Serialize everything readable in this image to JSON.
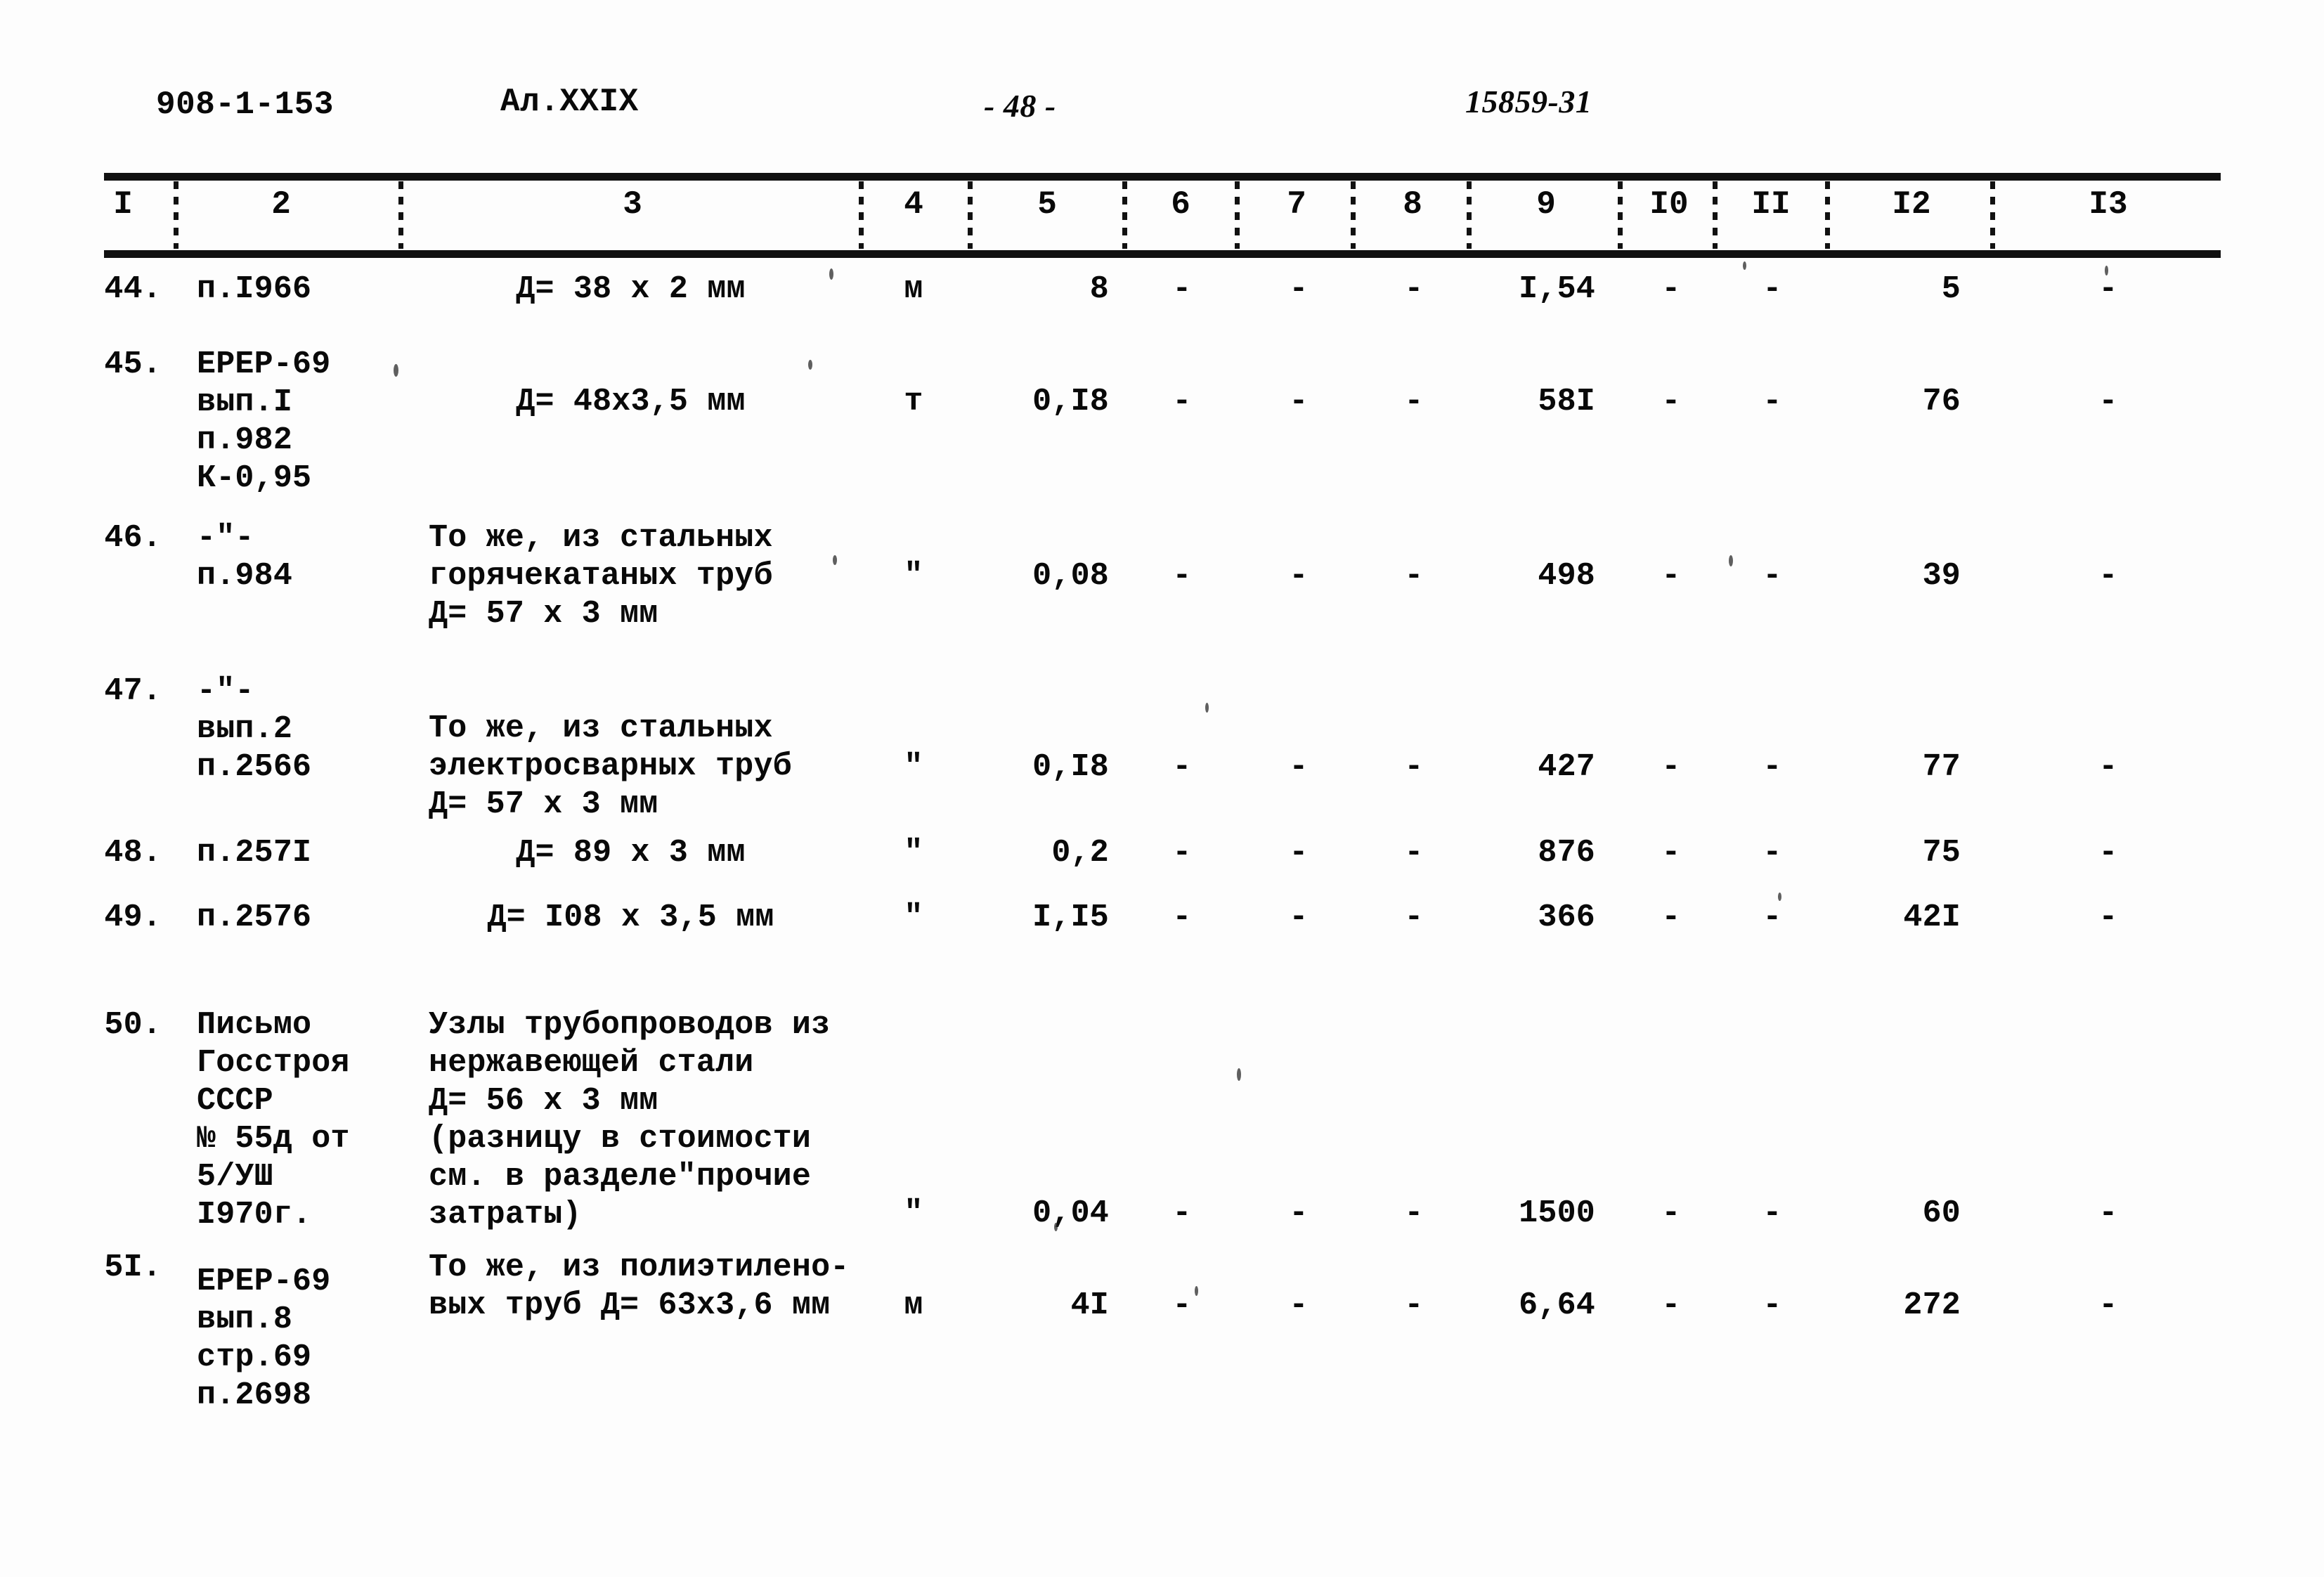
{
  "header": {
    "doc_code": "908-1-153",
    "album": "Ал.XXIX",
    "page_marker": "- 48 -",
    "stamp": "15859-31"
  },
  "table": {
    "column_headers": [
      "I",
      "2",
      "3",
      "4",
      "5",
      "6",
      "7",
      "8",
      "9",
      "I0",
      "II",
      "I2",
      "I3"
    ],
    "rows": [
      {
        "no": "44.",
        "code": [
          "п.I966"
        ],
        "desc": [
          "Д= 38 х 2 мм"
        ],
        "unit": "м",
        "c5": "8",
        "c6": "-",
        "c7": "-",
        "c8": "-",
        "c9": "I,54",
        "c10": "-",
        "c11": "-",
        "c12": "5",
        "c13": "-"
      },
      {
        "no": "45.",
        "code": [
          "ЕРЕР-69",
          "вып.I",
          "п.982",
          "К-0,95"
        ],
        "desc": [
          "Д= 48х3,5 мм"
        ],
        "unit": "т",
        "c5": "0,I8",
        "c6": "-",
        "c7": "-",
        "c8": "-",
        "c9": "58I",
        "c10": "-",
        "c11": "-",
        "c12": "76",
        "c13": "-"
      },
      {
        "no": "46.",
        "code": [
          "-\"-",
          "п.984"
        ],
        "desc": [
          "То же, из стальных",
          "горячекатаных труб",
          "Д= 57 х 3 мм"
        ],
        "unit": "\"",
        "c5": "0,08",
        "c6": "-",
        "c7": "-",
        "c8": "-",
        "c9": "498",
        "c10": "-",
        "c11": "-",
        "c12": "39",
        "c13": "-"
      },
      {
        "no": "47.",
        "code": [
          "-\"-",
          "вып.2",
          "п.2566"
        ],
        "desc": [
          "То же, из стальных",
          "электросварных труб",
          "Д= 57 х 3 мм"
        ],
        "unit": "\"",
        "c5": "0,I8",
        "c6": "-",
        "c7": "-",
        "c8": "-",
        "c9": "427",
        "c10": "-",
        "c11": "-",
        "c12": "77",
        "c13": "-"
      },
      {
        "no": "48.",
        "code": [
          "п.257I"
        ],
        "desc": [
          "Д= 89 х 3 мм"
        ],
        "unit": "\"",
        "c5": "0,2",
        "c6": "-",
        "c7": "-",
        "c8": "-",
        "c9": "876",
        "c10": "-",
        "c11": "-",
        "c12": "75",
        "c13": "-"
      },
      {
        "no": "49.",
        "code": [
          "п.2576"
        ],
        "desc": [
          "Д= I08 х 3,5 мм"
        ],
        "unit": "\"",
        "c5": "I,I5",
        "c6": "-",
        "c7": "-",
        "c8": "-",
        "c9": "366",
        "c10": "-",
        "c11": "-",
        "c12": "42I",
        "c13": "-"
      },
      {
        "no": "50.",
        "code": [
          "Письмо",
          "Госстроя",
          "СССР",
          "№ 55д от",
          "5/УШ",
          "I970г."
        ],
        "desc": [
          "Узлы трубопроводов из",
          "нержавеющей стали",
          "Д= 56 х 3 мм",
          "(разницу в стоимости",
          "см. в разделе\"прочие",
          "затраты)"
        ],
        "unit": "\"",
        "c5": "0,04",
        "c6": "-",
        "c7": "-",
        "c8": "-",
        "c9": "1500",
        "c10": "-",
        "c11": "-",
        "c12": "60",
        "c13": "-"
      },
      {
        "no": "5I.",
        "code": [
          "ЕРЕР-69",
          "вып.8",
          "стр.69",
          "п.2698"
        ],
        "desc": [
          "То же, из полиэтилено-",
          "вых труб Д= 63х3,6 мм"
        ],
        "unit": "м",
        "c5": "4I",
        "c6": "-",
        "c7": "-",
        "c8": "-",
        "c9": "6,64",
        "c10": "-",
        "c11": "-",
        "c12": "272",
        "c13": "-"
      }
    ]
  }
}
